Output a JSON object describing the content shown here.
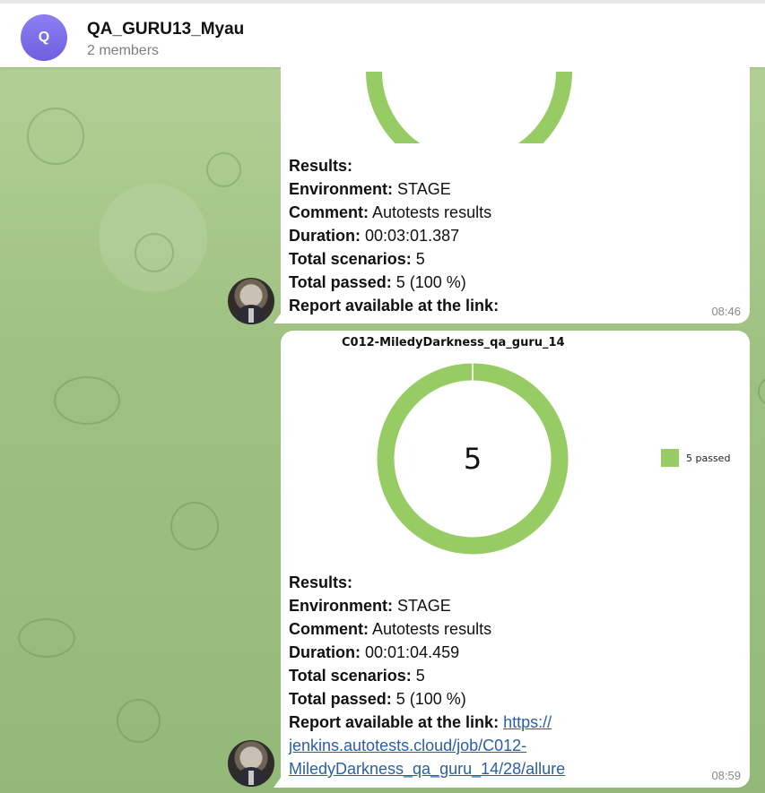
{
  "header": {
    "avatar_letter": "Q",
    "title": "QA_GURU13_Myau",
    "subtitle": "2 members"
  },
  "messages": [
    {
      "results_label": "Results:",
      "environment_label": "Environment:",
      "environment_value": "STAGE",
      "comment_label": "Comment:",
      "comment_value": "Autotests results",
      "duration_label": "Duration:",
      "duration_value": "00:03:01.387",
      "total_scenarios_label": "Total scenarios:",
      "total_scenarios_value": "5",
      "total_passed_label": "Total passed:",
      "total_passed_value": "5 (100 %)",
      "report_label": "Report available at the link:",
      "time": "08:46"
    },
    {
      "chart_title": "C012-MiledyDarkness_qa_guru_14",
      "chart_center": "5",
      "legend_label": "5 passed",
      "results_label": "Results:",
      "environment_label": "Environment:",
      "environment_value": "STAGE",
      "comment_label": "Comment:",
      "comment_value": "Autotests results",
      "duration_label": "Duration:",
      "duration_value": "00:01:04.459",
      "total_scenarios_label": "Total scenarios:",
      "total_scenarios_value": "5",
      "total_passed_label": "Total passed:",
      "total_passed_value": "5 (100 %)",
      "report_label": "Report available at the link:",
      "report_link_line1": "https://",
      "report_link_line2": "jenkins.autotests.cloud/job/C012-",
      "report_link_line3": "MiledyDarkness_qa_guru_14/28/allure",
      "time": "08:59"
    }
  ],
  "chart_data": {
    "type": "pie",
    "title": "C012-MiledyDarkness_qa_guru_14",
    "categories": [
      "passed"
    ],
    "values": [
      5
    ],
    "legend": [
      "5 passed"
    ],
    "colors": [
      "#97cc64"
    ],
    "legend_position": "right"
  }
}
